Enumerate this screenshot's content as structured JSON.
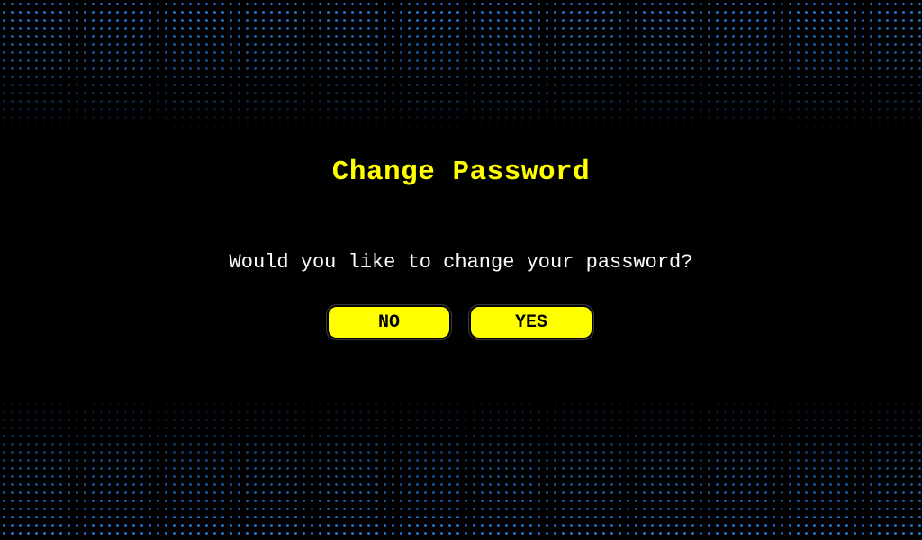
{
  "colors": {
    "background": "#000000",
    "accent": "#ffff00",
    "message_text": "#ffffff",
    "dot_pattern": "#1e7be0"
  },
  "dialog": {
    "title": "Change Password",
    "message": "Would you like to change your password?",
    "buttons": {
      "no_label": "NO",
      "yes_label": "YES"
    }
  }
}
